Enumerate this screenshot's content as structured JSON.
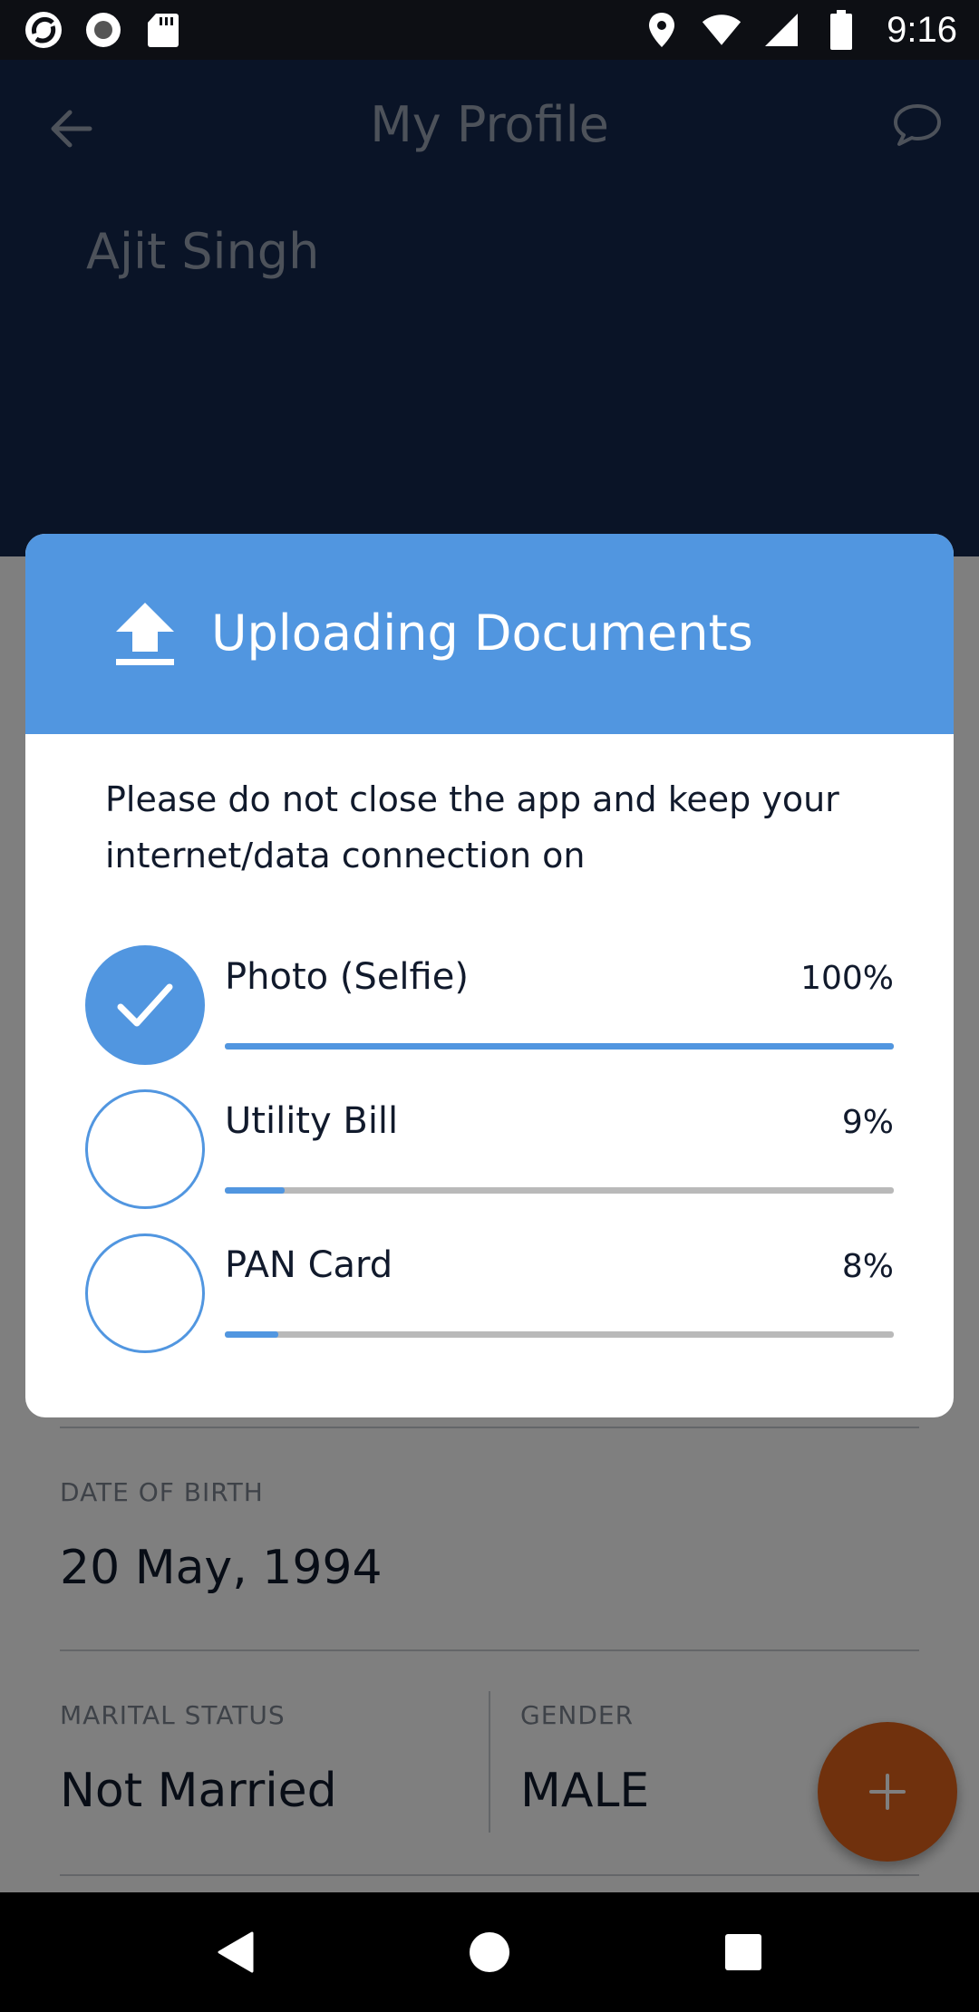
{
  "status_bar": {
    "time": "9:16",
    "left_icons": [
      "app-notification-icon",
      "record-icon",
      "sd-card-icon"
    ],
    "right_icons": [
      "location-icon",
      "wifi-icon",
      "signal-icon",
      "battery-icon"
    ]
  },
  "header": {
    "title": "My Profile",
    "back_icon": "arrow-back-icon",
    "chat_icon": "chat-bubble-icon",
    "profile_name": "Ajit Singh"
  },
  "profile": {
    "dob_label": "DATE OF BIRTH",
    "dob_value": "20 May, 1994",
    "marital_label": "MARITAL STATUS",
    "marital_value": "Not Married",
    "gender_label": "GENDER",
    "gender_value": "MALE",
    "fab_icon": "plus-icon"
  },
  "dialog": {
    "title": "Uploading Documents",
    "icon": "upload-icon",
    "message": "Please do not close the app and keep your internet/data connection on",
    "documents": [
      {
        "name": "Photo (Selfie)",
        "percent_text": "100%",
        "progress": 1.0,
        "done": true
      },
      {
        "name": "Utility Bill",
        "percent_text": "9%",
        "progress": 0.09,
        "done": false
      },
      {
        "name": "PAN Card",
        "percent_text": "8%",
        "progress": 0.08,
        "done": false
      }
    ]
  },
  "colors": {
    "accent": "#5196e0",
    "header_bg": "#14284f",
    "fab": "#e0621a",
    "text_dark": "#111a2c",
    "track": "#b9b9b9"
  },
  "nav_bar": {
    "back": "nav-back-icon",
    "home": "nav-home-icon",
    "recents": "nav-recents-icon"
  }
}
